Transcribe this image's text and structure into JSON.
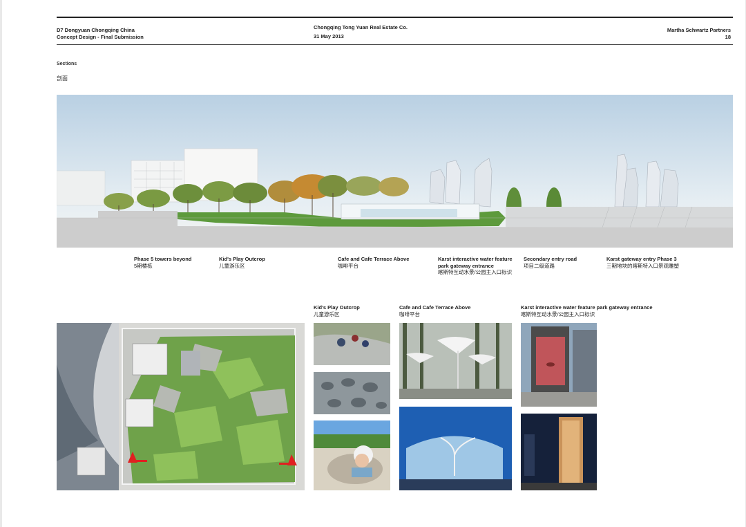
{
  "header": {
    "left_line1": "D7 Dongyuan Chongqing China",
    "left_line2": "Concept Design - Final Submission",
    "center_line1": "Chongqing Tong Yuan Real Estate Co.",
    "center_line2": "31 May 2013",
    "right_line1": "Martha Schwartz Partners",
    "right_line2": "18"
  },
  "section": {
    "title": "Sections",
    "title_cn": "剖面"
  },
  "section_labels": [
    {
      "en": "Phase 5 towers beyond",
      "cn": "5期楼栋"
    },
    {
      "en": "Kid's Play Outcrop",
      "cn": "儿童游乐区"
    },
    {
      "en": "Cafe and Cafe Terrace Above",
      "cn": "咖啡平台"
    },
    {
      "en": "Karst interactive water feature park gateway entrance",
      "en2": "park gateway entrance",
      "cn": "喀斯特互动水景/公园主入口标识"
    },
    {
      "en": "Secondary entry road",
      "cn": "项目二级道路"
    },
    {
      "en": "Karst gateway entry Phase 3",
      "cn": "三期地块的喀斯特入口景观雕塑"
    }
  ],
  "photo_groups": [
    {
      "en": "Kid's Play Outcrop",
      "cn": "儿童游乐区"
    },
    {
      "en": "Cafe and Cafe Terrace Above",
      "cn": "咖啡平台"
    },
    {
      "en": "Karst interactive water feature park gateway entrance",
      "cn": "喀斯特互动水景/公园主入口标识"
    }
  ],
  "colors": {
    "sky": "#cfe0ec",
    "grass": "#5d9a3c",
    "ground": "#cfcfcf",
    "arrow": "#e02020"
  }
}
